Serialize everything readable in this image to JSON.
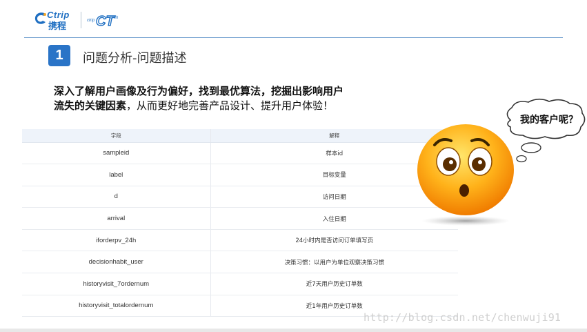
{
  "header": {
    "ctrip_logo_en": "Ctrip",
    "ctrip_logo_cn": "携程",
    "ct_logo_left": "ctrip",
    "ct_logo_right": "tech",
    "ct_logo_mark": "CT",
    "accent_color": "#2a74c7"
  },
  "section": {
    "number": "1",
    "title": "问题分析-问题描述"
  },
  "description": {
    "bold_text": "深入了解用户画像及行为偏好，找到最优算法，挖掘出影响用户流失的关键因素",
    "normal_text": "，从而更好地完善产品设计、提升用户体验！"
  },
  "table": {
    "headers": [
      "字段",
      "解释"
    ],
    "rows": [
      {
        "field": "sampleid",
        "meaning": "样本id"
      },
      {
        "field": "label",
        "meaning": "目标变量"
      },
      {
        "field": "d",
        "meaning": "访问日期"
      },
      {
        "field": "arrival",
        "meaning": "入住日期"
      },
      {
        "field": "iforderpv_24h",
        "meaning": "24小时内是否访问订单填写页"
      },
      {
        "field": "decisionhabit_user",
        "meaning": "决策习惯：以用户为单位观察决策习惯"
      },
      {
        "field": "historyvisit_7ordernum",
        "meaning": "近7天用户历史订单数"
      },
      {
        "field": "historyvisit_totalordernum",
        "meaning": "近1年用户历史订单数"
      }
    ]
  },
  "bubble": {
    "text": "我的客户呢？",
    "emoji_icon": "surprised-face-icon"
  },
  "watermark": "http://blog.csdn.net/chenwuji91"
}
